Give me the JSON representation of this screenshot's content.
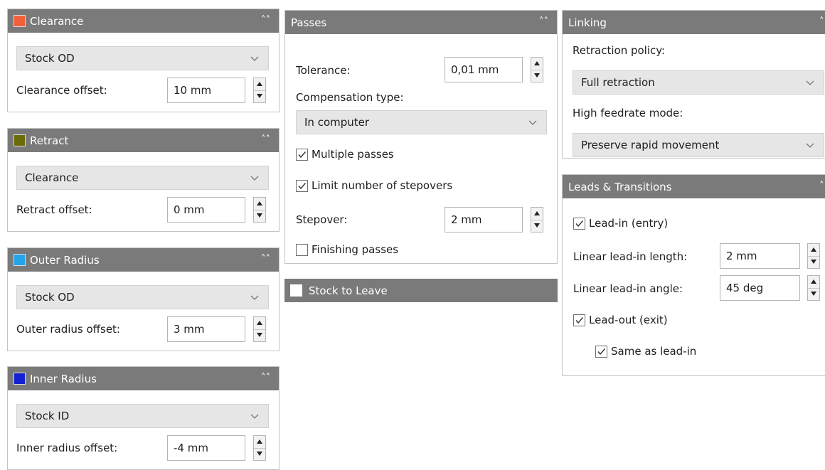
{
  "clearance": {
    "title": "Clearance",
    "color": "#f2603a",
    "dropdown": "Stock OD",
    "offset_label": "Clearance offset:",
    "offset_value": "10 mm"
  },
  "retract": {
    "title": "Retract",
    "color": "#6b6b0a",
    "dropdown": "Clearance",
    "offset_label": "Retract offset:",
    "offset_value": "0 mm"
  },
  "outer_radius": {
    "title": "Outer Radius",
    "color": "#23a3e8",
    "dropdown": "Stock OD",
    "offset_label": "Outer radius offset:",
    "offset_value": "3 mm"
  },
  "inner_radius": {
    "title": "Inner Radius",
    "color": "#1420d2",
    "dropdown": "Stock ID",
    "offset_label": "Inner radius offset:",
    "offset_value": "-4 mm"
  },
  "passes": {
    "title": "Passes",
    "tolerance_label": "Tolerance:",
    "tolerance_value": "0,01 mm",
    "compensation_label": "Compensation type:",
    "compensation_value": "In computer",
    "multiple_passes": {
      "label": "Multiple passes",
      "checked": true
    },
    "limit_stepovers": {
      "label": "Limit number of stepovers",
      "checked": true
    },
    "stepover_label": "Stepover:",
    "stepover_value": "2 mm",
    "finishing_passes": {
      "label": "Finishing passes",
      "checked": false
    }
  },
  "stock_to_leave": {
    "title": "Stock to Leave",
    "checked": false
  },
  "linking": {
    "title": "Linking",
    "retraction_label": "Retraction policy:",
    "retraction_value": "Full retraction",
    "feedrate_label": "High feedrate mode:",
    "feedrate_value": "Preserve rapid movement"
  },
  "leads": {
    "title": "Leads & Transitions",
    "lead_in": {
      "label": "Lead-in (entry)",
      "checked": true
    },
    "length_label": "Linear lead-in length:",
    "length_value": "2 mm",
    "angle_label": "Linear lead-in angle:",
    "angle_value": "45 deg",
    "lead_out": {
      "label": "Lead-out (exit)",
      "checked": true
    },
    "same_as_lead_in": {
      "label": "Same as lead-in",
      "checked": true
    }
  },
  "icons": {
    "collapse": "double-chevron-up-icon",
    "dropdown": "chevron-down-icon",
    "check": "checkmark-icon",
    "spinner": "spin-arrows-icon"
  }
}
